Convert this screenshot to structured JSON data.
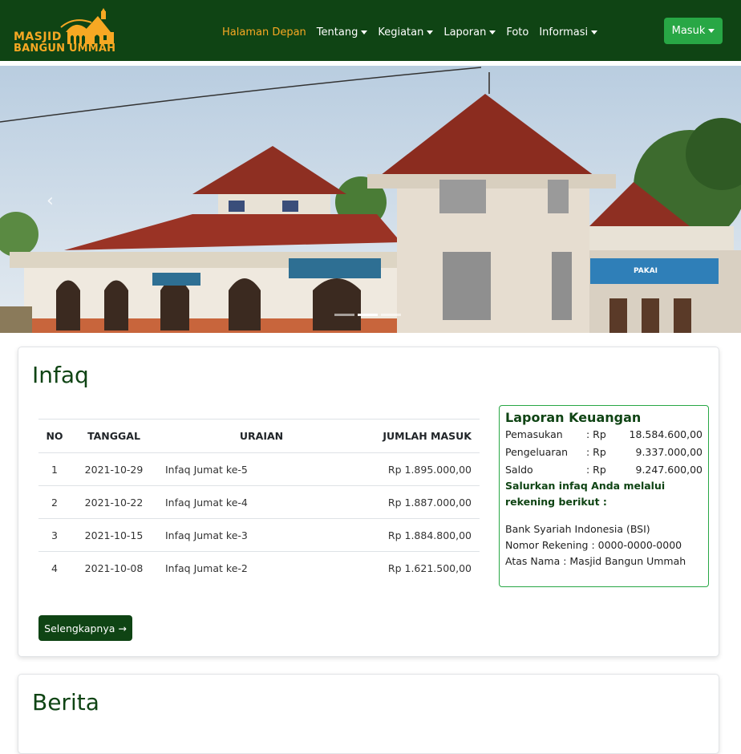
{
  "brand": {
    "line1": "MASJID",
    "line2": "BANGUN UMMAH"
  },
  "nav": {
    "items": [
      {
        "label": "Halaman Depan",
        "active": true,
        "dropdown": false
      },
      {
        "label": "Tentang",
        "active": false,
        "dropdown": true
      },
      {
        "label": "Kegiatan",
        "active": false,
        "dropdown": true
      },
      {
        "label": "Laporan",
        "active": false,
        "dropdown": true
      },
      {
        "label": "Foto",
        "active": false,
        "dropdown": false
      },
      {
        "label": "Informasi",
        "active": false,
        "dropdown": true
      }
    ],
    "login_label": "Masuk"
  },
  "hero": {
    "sign_text": "PAKAI",
    "carousel": {
      "prev_icon": "‹",
      "slides": 3,
      "active_index": 1
    }
  },
  "infaq": {
    "title": "Infaq",
    "table": {
      "headers": [
        "NO",
        "TANGGAL",
        "URAIAN",
        "JUMLAH MASUK"
      ],
      "rows": [
        [
          "1",
          "2021-10-29",
          "Infaq Jumat ke-5",
          "Rp 1.895.000,00"
        ],
        [
          "2",
          "2021-10-22",
          "Infaq Jumat ke-4",
          "Rp 1.887.000,00"
        ],
        [
          "3",
          "2021-10-15",
          "Infaq Jumat ke-3",
          "Rp 1.884.800,00"
        ],
        [
          "4",
          "2021-10-08",
          "Infaq Jumat ke-2",
          "Rp 1.621.500,00"
        ]
      ]
    },
    "more_label": "Selengkapnya →"
  },
  "finance": {
    "title": "Laporan Keuangan",
    "rows": [
      {
        "label": "Pemasukan",
        "currency": ": Rp",
        "value": "18.584.600,00"
      },
      {
        "label": "Pengeluaran",
        "currency": ": Rp",
        "value": "9.337.000,00"
      },
      {
        "label": "Saldo",
        "currency": ": Rp",
        "value": "9.247.600,00"
      }
    ],
    "note": "Salurkan infaq Anda melalui rekening berikut :",
    "bank": "Bank Syariah Indonesia (BSI)",
    "account": "Nomor Rekening : 0000-0000-0000",
    "holder": "Atas Nama : Masjid Bangun Ummah"
  },
  "berita": {
    "title": "Berita"
  },
  "colors": {
    "primary": "#0f4414",
    "accent": "#f7a823",
    "success": "#28a745"
  }
}
